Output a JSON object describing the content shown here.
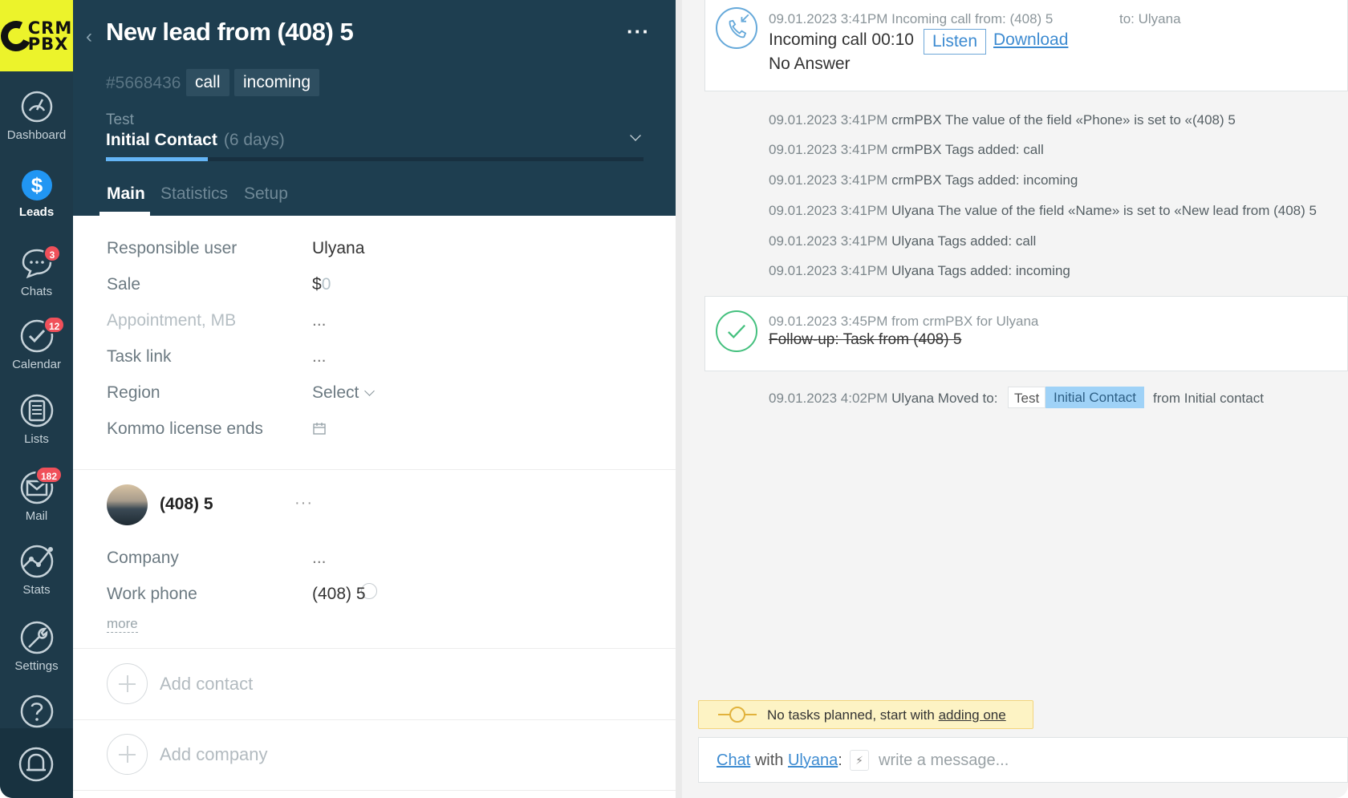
{
  "nav": {
    "logo_text_line1": "CRM",
    "logo_text_line2": "PBX",
    "items": [
      {
        "label": "Dashboard",
        "icon": "dashboard-icon"
      },
      {
        "label": "Leads",
        "icon": "leads-icon"
      },
      {
        "label": "Chats",
        "icon": "chats-icon",
        "badge": "3"
      },
      {
        "label": "Calendar",
        "icon": "calendar-icon",
        "badge": "12"
      },
      {
        "label": "Lists",
        "icon": "lists-icon"
      },
      {
        "label": "Mail",
        "icon": "mail-icon",
        "badge": "182"
      },
      {
        "label": "Stats",
        "icon": "stats-icon"
      },
      {
        "label": "Settings",
        "icon": "settings-icon"
      }
    ],
    "active": "Leads"
  },
  "lead": {
    "title": "New lead from (408) 5",
    "id": "#5668436",
    "tags": [
      "call",
      "incoming"
    ],
    "pipeline": "Test",
    "stage": "Initial Contact",
    "stage_days": "(6 days)",
    "tabs": [
      "Main",
      "Statistics",
      "Setup"
    ],
    "active_tab": "Main"
  },
  "fields": [
    {
      "label": "Responsible user",
      "value": "Ulyana"
    },
    {
      "label": "Sale",
      "value_currency": "$",
      "value_amount": "0"
    },
    {
      "label": "Appointment, MB",
      "value": "..."
    },
    {
      "label": "Task link",
      "value": "..."
    },
    {
      "label": "Region",
      "value": "Select"
    },
    {
      "label": "Kommo license ends",
      "value": ""
    }
  ],
  "contact": {
    "name": "(408) 5",
    "menu": "...",
    "company_label": "Company",
    "company_value": "...",
    "phone_label": "Work phone",
    "phone_value": "(408) 5",
    "more": "more"
  },
  "add_contact": "Add contact",
  "add_company": "Add company",
  "feed": {
    "call": {
      "meta": "09.01.2023 3:41PM Incoming call from: (408) 5",
      "to": "to: Ulyana",
      "line": "Incoming call 00:10",
      "listen": "Listen",
      "download": "Download",
      "status": "No Answer"
    },
    "notes": [
      {
        "time": "09.01.2023 3:41PM",
        "text": "crmPBX The value of the field «Phone» is set to «(408) 5"
      },
      {
        "time": "09.01.2023 3:41PM",
        "text": "crmPBX Tags added: call"
      },
      {
        "time": "09.01.2023 3:41PM",
        "text": "crmPBX Tags added: incoming"
      },
      {
        "time": "09.01.2023 3:41PM",
        "text": "Ulyana The value of the field «Name» is set to «New lead from (408) 5"
      },
      {
        "time": "09.01.2023 3:41PM",
        "text": "Ulyana Tags added: call"
      },
      {
        "time": "09.01.2023 3:41PM",
        "text": "Ulyana Tags added: incoming"
      }
    ],
    "task": {
      "meta": "09.01.2023 3:45PM  from crmPBX for Ulyana",
      "title": "Follow-up: Task from (408) 5"
    },
    "moved": {
      "time": "09.01.2023 4:02PM",
      "text": "Ulyana Moved to:",
      "pipeline": "Test",
      "stage": "Initial Contact",
      "from": "from Initial contact"
    },
    "no_tasks": "No tasks planned, start with",
    "no_tasks_link": "adding one",
    "chat_word": "Chat",
    "chat_with": "with",
    "chat_user": "Ulyana",
    "chat_colon": ":",
    "chat_placeholder": "write a message..."
  },
  "colors": {
    "nav_bg": "#1e3a4a",
    "header_bg": "#1e3e50",
    "logo_bg": "#ecf32b",
    "accent_blue": "#3d8bd1",
    "badge_red": "#f0505a",
    "success_green": "#44c07e"
  },
  "progress": {
    "stage_fraction": 0.19
  }
}
